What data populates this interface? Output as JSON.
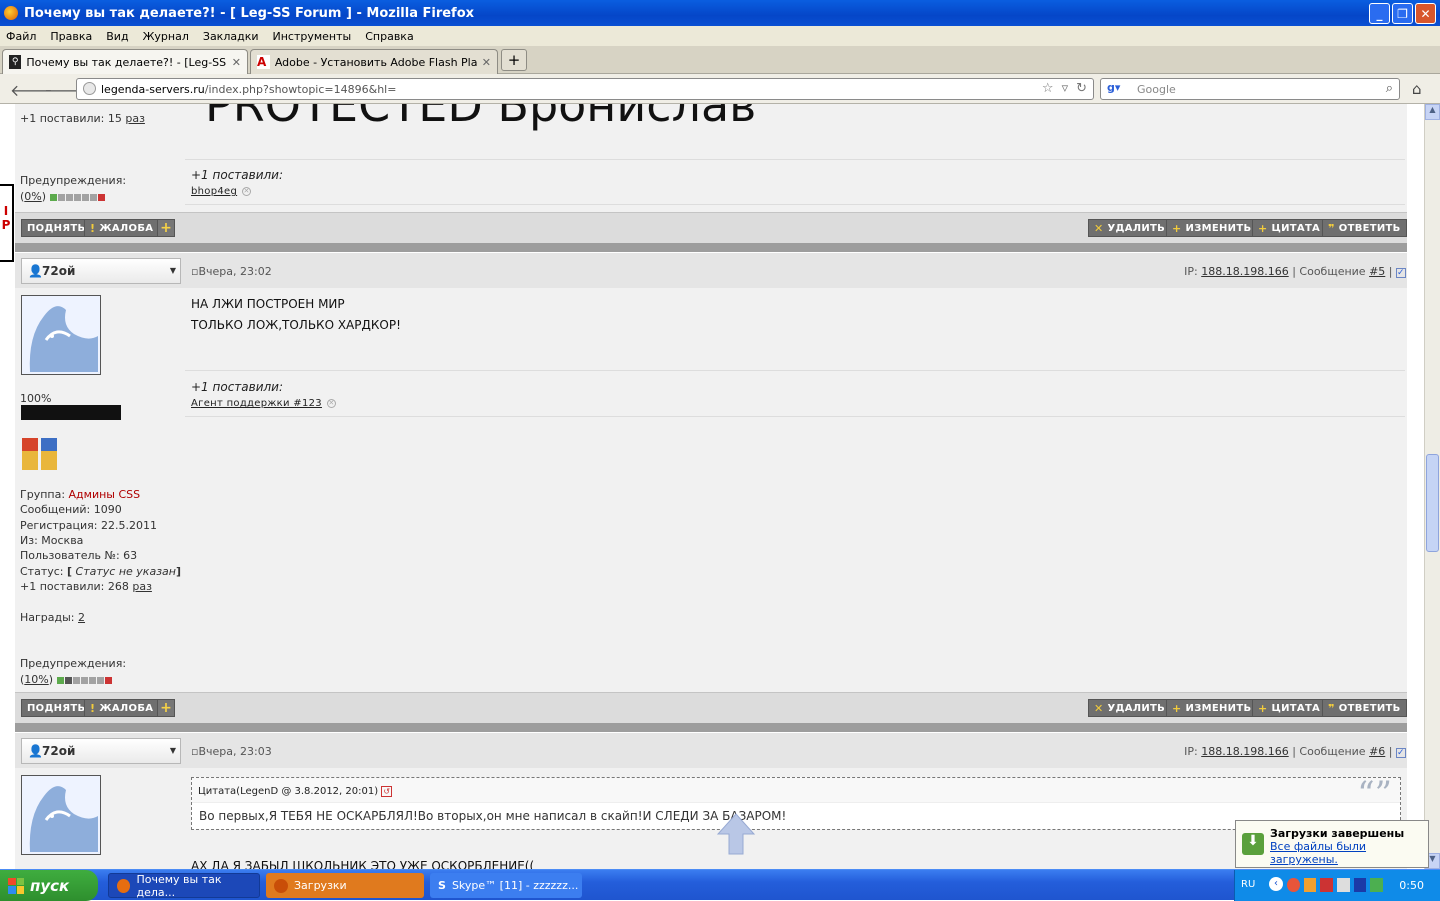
{
  "window": {
    "title": "Почему вы так делаете?! - [ Leg-SS Forum ] - Mozilla Firefox"
  },
  "menu": [
    "Файл",
    "Правка",
    "Вид",
    "Журнал",
    "Закладки",
    "Инструменты",
    "Справка"
  ],
  "tabs": [
    {
      "label": "Почему вы так делаете?! - [Leg-SS Fo..."
    },
    {
      "label": "Adobe - Установить Adobe Flash Player"
    }
  ],
  "url": {
    "host": "legenda-servers.ru",
    "path": "/index.php?showtopic=14896&hl="
  },
  "search": {
    "placeholder": "Google"
  },
  "top_partial": {
    "heading_fragment": "PROTECTED Бронислав",
    "plus_count_label": "+1 поставили: 15",
    "plus_count_link": "раз",
    "warn_label": "Предупреждения:",
    "warn_pct": "0%",
    "rep_label": "+1 поставили:",
    "rep_user": "bhop4eg"
  },
  "buttons": {
    "up": "ПОДНЯТЬ",
    "report": "ЖАЛОБА",
    "delete": "УДАЛИТЬ",
    "edit": "ИЗМЕНИТЬ",
    "quote": "ЦИТАТА",
    "reply": "ОТВЕТИТЬ"
  },
  "post5": {
    "user": "72ой",
    "date": "Вчера, 23:02",
    "ip_label": "IP:",
    "ip": "188.18.198.166",
    "msg_label": "| Сообщение",
    "msg_num": "#5",
    "lines": [
      "НА ЛЖИ ПОСТРОЕН МИР",
      "ТОЛЬКО ЛОЖ,ТОЛЬКО ХАРДКОР!"
    ],
    "rep_label": "+1 поставили:",
    "rep_user": "Агент поддержки #123",
    "percent": "100%",
    "group_label": "Группа:",
    "group": "Админы CSS",
    "posts": "Сообщений: 1090",
    "reg": "Регистрация: 22.5.2011",
    "from": "Из: Москва",
    "user_no": "Пользователь №: 63",
    "status_label": "Статус:",
    "status": "Статус не указан",
    "plus_label": "+1 поставили: 268",
    "plus_link": "раз",
    "awards_label": "Награды:",
    "awards": "2",
    "warn_label": "Предупреждения:",
    "warn_pct": "10%"
  },
  "post6": {
    "user": "72ой",
    "date": "Вчера, 23:03",
    "ip_label": "IP:",
    "ip": "188.18.198.166",
    "msg_label": "| Сообщение",
    "msg_num": "#6",
    "quote_header": "Цитата(LegenD @ 3.8.2012, 20:01)",
    "quote_text": "Во первых,Я ТЕБЯ НЕ ОСКАРБЛЯЛ!Во вторых,он мне написал в скайп!И СЛЕДИ ЗА БАЗАРОМ!",
    "text_partial": "АХ ДА Я ЗАБЫЛ ШКОЛЬНИК ЭТО УЖЕ ОСКОРБЛЕНИЕ(("
  },
  "downloads_popup": {
    "title": "Загрузки завершены",
    "link": "Все файлы были загружены."
  },
  "taskbar": {
    "start": "пуск",
    "tasks": [
      "Почему вы так дела...",
      "Загрузки",
      "Skype™ [11] - zzzzzz..."
    ],
    "lang": "RU",
    "clock": "0:50"
  },
  "colors": {
    "group": "#b00000",
    "accent_link": "#0040c0"
  }
}
